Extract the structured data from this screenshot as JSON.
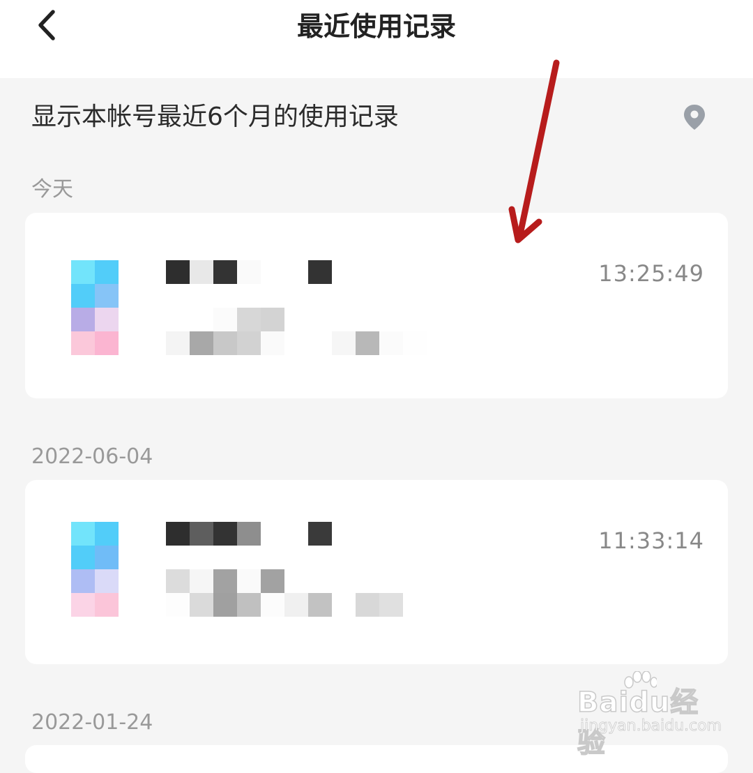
{
  "header": {
    "title": "最近使用记录",
    "back_icon": "chevron-left-icon"
  },
  "notice": {
    "text": "显示本帐号最近6个月的使用记录",
    "icon": "location-pin-icon",
    "icon_color": "#9aa0a8"
  },
  "groups": [
    {
      "date": "今天",
      "records": [
        {
          "time": "13:25:49"
        }
      ]
    },
    {
      "date": "2022-06-04",
      "records": [
        {
          "time": "11:33:14"
        }
      ]
    },
    {
      "date": "2022-01-24",
      "records": []
    }
  ],
  "watermark": {
    "brand": "Baidu经验",
    "url": "jingyan.baidu.com"
  },
  "colors": {
    "background": "#f5f5f5",
    "card": "#ffffff",
    "annotation_arrow": "#b71c1c"
  }
}
